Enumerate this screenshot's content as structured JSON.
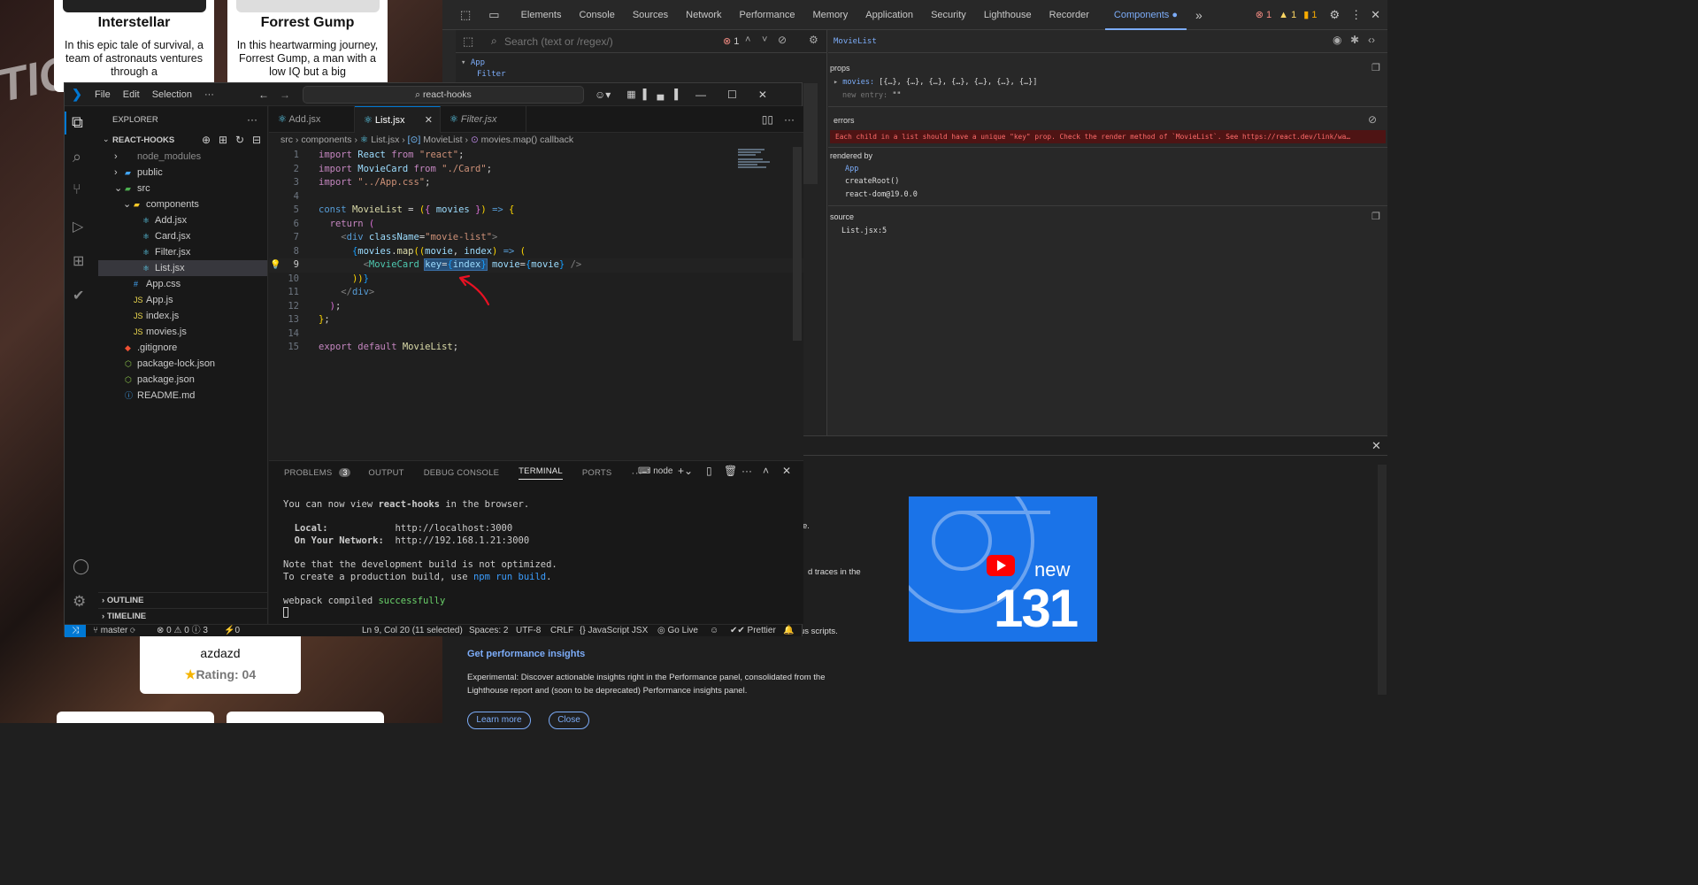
{
  "background_page": {
    "cards": [
      {
        "title": "Interstellar",
        "desc": "In this epic tale of survival, a team of astronauts ventures through a"
      },
      {
        "title": "Forrest Gump",
        "desc": "In this heartwarming journey, Forrest Gump, a man with a low IQ but a big"
      }
    ],
    "bottom_card": {
      "title": "azdazd",
      "rating_label": "Rating: 04"
    }
  },
  "devtools": {
    "tabs": [
      "Elements",
      "Console",
      "Sources",
      "Network",
      "Performance",
      "Memory",
      "Application",
      "Security",
      "Lighthouse",
      "Recorder",
      "Components"
    ],
    "active_tab": "Components",
    "badges": {
      "errors": "1",
      "warnings": "1",
      "issues": "1"
    },
    "search_placeholder": "Search (text or /regex/)",
    "error_count": "1",
    "tree": {
      "app": "App",
      "filter": "Filter"
    },
    "component_name": "MovieList",
    "props_label": "props",
    "props_movies_key": "movies:",
    "props_movies_value": "[{…}, {…}, {…}, {…}, {…}, {…}, {…}]",
    "new_entry_key": "new entry:",
    "new_entry_value": "\"\"",
    "errors_label": "errors",
    "error_message": "Each child in a list should have a unique \"key\" prop. Check the render method of `MovieList`. See https://react.dev/link/wa…",
    "rendered_by_label": "rendered by",
    "rendered_by": [
      "App",
      "createRoot()",
      "react-dom@19.0.0"
    ],
    "source_label": "source",
    "source_value": "List.jsx:5",
    "drawer": {
      "text1_fragment": "e.",
      "text2_fragment": "d traces in the",
      "text3_fragment": "us scripts.",
      "heading": "Get performance insights",
      "body_line1": "Experimental: Discover actionable insights right in the Performance panel, consolidated from the",
      "body_line2": "Lighthouse report and (soon to be deprecated) Performance insights panel.",
      "learn_more": "Learn more",
      "close": "Close",
      "promo_new": "new",
      "promo_version": "131"
    }
  },
  "vscode": {
    "menu": [
      "File",
      "Edit",
      "Selection",
      "···"
    ],
    "search_box": "react-hooks",
    "explorer_title": "EXPLORER",
    "project_name": "REACT-HOOKS",
    "tree": [
      {
        "label": "node_modules",
        "indent": 1,
        "kind": "folder-closed",
        "icon": "none"
      },
      {
        "label": "public",
        "indent": 1,
        "kind": "folder-closed",
        "icon": "public"
      },
      {
        "label": "src",
        "indent": 1,
        "kind": "folder-open",
        "icon": "src"
      },
      {
        "label": "components",
        "indent": 2,
        "kind": "folder-open",
        "icon": "components"
      },
      {
        "label": "Add.jsx",
        "indent": 3,
        "kind": "file",
        "icon": "react"
      },
      {
        "label": "Card.jsx",
        "indent": 3,
        "kind": "file",
        "icon": "react"
      },
      {
        "label": "Filter.jsx",
        "indent": 3,
        "kind": "file",
        "icon": "react"
      },
      {
        "label": "List.jsx",
        "indent": 3,
        "kind": "file",
        "icon": "react",
        "selected": true
      },
      {
        "label": "App.css",
        "indent": 2,
        "kind": "file",
        "icon": "css"
      },
      {
        "label": "App.js",
        "indent": 2,
        "kind": "file",
        "icon": "js"
      },
      {
        "label": "index.js",
        "indent": 2,
        "kind": "file",
        "icon": "js"
      },
      {
        "label": "movies.js",
        "indent": 2,
        "kind": "file",
        "icon": "js"
      },
      {
        "label": ".gitignore",
        "indent": 1,
        "kind": "file",
        "icon": "git"
      },
      {
        "label": "package-lock.json",
        "indent": 1,
        "kind": "file",
        "icon": "npm"
      },
      {
        "label": "package.json",
        "indent": 1,
        "kind": "file",
        "icon": "npm"
      },
      {
        "label": "README.md",
        "indent": 1,
        "kind": "file",
        "icon": "info"
      }
    ],
    "outline_label": "OUTLINE",
    "timeline_label": "TIMELINE",
    "tabs": [
      {
        "label": "Add.jsx",
        "active": false,
        "italic": false
      },
      {
        "label": "List.jsx",
        "active": true,
        "italic": false
      },
      {
        "label": "Filter.jsx",
        "active": false,
        "italic": true
      }
    ],
    "breadcrumb": [
      "src",
      "components",
      "List.jsx",
      "MovieList",
      "movies.map() callback"
    ],
    "code_line_numbers": [
      "1",
      "2",
      "3",
      "4",
      "5",
      "6",
      "7",
      "8",
      "9",
      "10",
      "11",
      "12",
      "13",
      "14",
      "15"
    ],
    "panel_tabs": [
      "PROBLEMS",
      "OUTPUT",
      "DEBUG CONSOLE",
      "TERMINAL",
      "PORTS"
    ],
    "problems_count": "3",
    "terminal_name": "node",
    "terminal": {
      "line1_pre": "You can now view ",
      "line1_app": "react-hooks",
      "line1_post": " in the browser.",
      "local_label": "  Local:",
      "local_url": "http://localhost:3000",
      "network_label": "  On Your Network:",
      "network_url": "http://192.168.1.21:3000",
      "note1": "Note that the development build is not optimized.",
      "note2_pre": "To create a production build, use ",
      "note2_cmd": "npm run build",
      "note2_post": ".",
      "compiled_pre": "webpack compiled ",
      "compiled_status": "successfully"
    },
    "status": {
      "branch": "master",
      "problems": "⊗ 0 ⚠ 0 ⓘ 3",
      "ports": "⚡0",
      "position": "Ln 9, Col 20 (11 selected)",
      "spaces": "Spaces: 2",
      "encoding": "UTF-8",
      "eol": "CRLF",
      "language": "JavaScript JSX",
      "golive": "Go Live",
      "prettier": "Prettier"
    }
  }
}
